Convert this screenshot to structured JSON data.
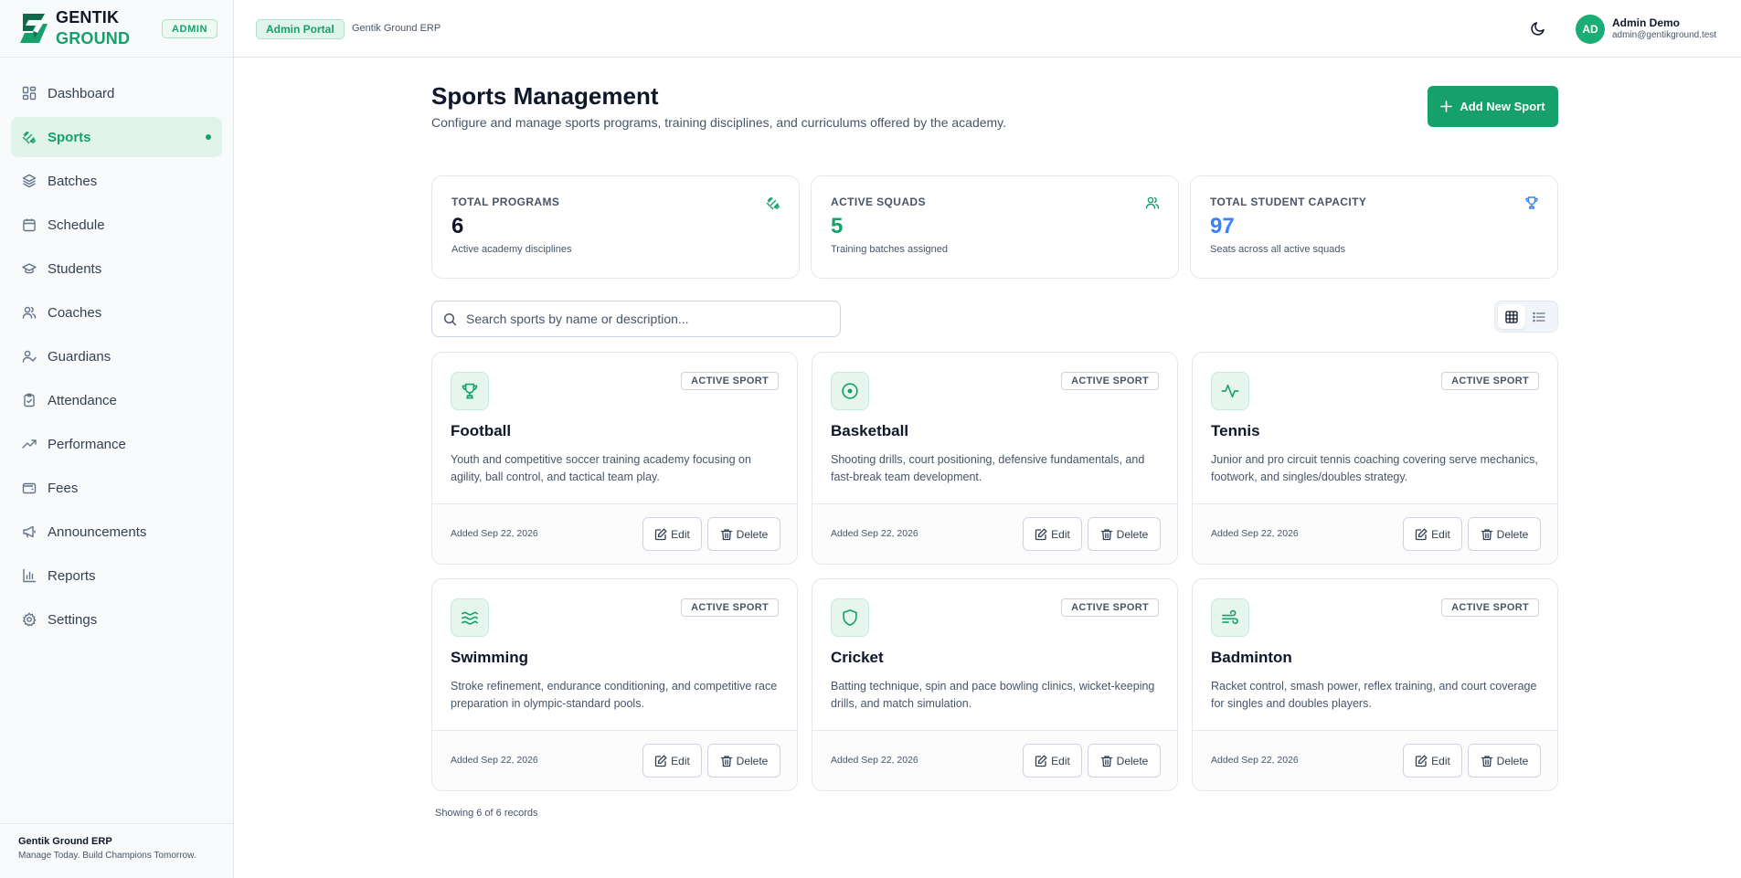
{
  "brand": {
    "line1": "GENTIK",
    "line2": "GROUND",
    "role_badge": "ADMIN"
  },
  "nav": [
    {
      "label": "Dashboard",
      "icon": "grid-icon"
    },
    {
      "label": "Sports",
      "icon": "dumbbell-icon",
      "active": true
    },
    {
      "label": "Batches",
      "icon": "layers-icon"
    },
    {
      "label": "Schedule",
      "icon": "calendar-icon"
    },
    {
      "label": "Students",
      "icon": "graduation-cap-icon"
    },
    {
      "label": "Coaches",
      "icon": "users-icon"
    },
    {
      "label": "Guardians",
      "icon": "user-check-icon"
    },
    {
      "label": "Attendance",
      "icon": "clipboard-check-icon"
    },
    {
      "label": "Performance",
      "icon": "trending-up-icon"
    },
    {
      "label": "Fees",
      "icon": "wallet-icon"
    },
    {
      "label": "Announcements",
      "icon": "megaphone-icon"
    },
    {
      "label": "Reports",
      "icon": "bar-chart-icon"
    },
    {
      "label": "Settings",
      "icon": "gear-icon"
    }
  ],
  "sidebar_footer": {
    "title": "Gentik Ground ERP",
    "tagline": "Manage Today. Build Champions Tomorrow."
  },
  "topbar": {
    "portal": "Admin Portal",
    "app_name": "Gentik Ground ERP",
    "user": {
      "initials": "AD",
      "name": "Admin Demo",
      "email": "admin@gentikground.test"
    }
  },
  "page": {
    "title": "Sports Management",
    "subtitle": "Configure and manage sports programs, training disciplines, and curriculums offered by the academy.",
    "add_button": "Add New Sport"
  },
  "stats": [
    {
      "label": "TOTAL PROGRAMS",
      "value": "6",
      "desc": "Active academy disciplines",
      "color": "#0f172a",
      "icon": "dumbbell-icon",
      "icon_color": "#16a06a"
    },
    {
      "label": "ACTIVE SQUADS",
      "value": "5",
      "desc": "Training batches assigned",
      "color": "#16a06a",
      "icon": "users-icon",
      "icon_color": "#16a06a"
    },
    {
      "label": "TOTAL STUDENT CAPACITY",
      "value": "97",
      "desc": "Seats across all active squads",
      "color": "#3b82f6",
      "icon": "trophy-icon",
      "icon_color": "#3b82f6"
    }
  ],
  "search": {
    "placeholder": "Search sports by name or description..."
  },
  "sports": [
    {
      "name": "Football",
      "icon": "trophy-icon",
      "badge": "ACTIVE SPORT",
      "description": "Youth and competitive soccer training academy focusing on agility, ball control, and tactical team play.",
      "added": "Added Sep 22, 2026"
    },
    {
      "name": "Basketball",
      "icon": "target-icon",
      "badge": "ACTIVE SPORT",
      "description": "Shooting drills, court positioning, defensive fundamentals, and fast-break team development.",
      "added": "Added Sep 22, 2026"
    },
    {
      "name": "Tennis",
      "icon": "activity-icon",
      "badge": "ACTIVE SPORT",
      "description": "Junior and pro circuit tennis coaching covering serve mechanics, footwork, and singles/doubles strategy.",
      "added": "Added Sep 22, 2026"
    },
    {
      "name": "Swimming",
      "icon": "waves-icon",
      "badge": "ACTIVE SPORT",
      "description": "Stroke refinement, endurance conditioning, and competitive race preparation in olympic-standard pools.",
      "added": "Added Sep 22, 2026"
    },
    {
      "name": "Cricket",
      "icon": "shield-icon",
      "badge": "ACTIVE SPORT",
      "description": "Batting technique, spin and pace bowling clinics, wicket-keeping drills, and match simulation.",
      "added": "Added Sep 22, 2026"
    },
    {
      "name": "Badminton",
      "icon": "wind-icon",
      "badge": "ACTIVE SPORT",
      "description": "Racket control, smash power, reflex training, and court coverage for singles and doubles players.",
      "added": "Added Sep 22, 2026"
    }
  ],
  "card_actions": {
    "edit": "Edit",
    "delete": "Delete"
  },
  "records_text": "Showing 6 of 6 records",
  "colors": {
    "accent": "#16a06a",
    "accent_soft": "#e1f4eb",
    "blue": "#3b82f6"
  }
}
